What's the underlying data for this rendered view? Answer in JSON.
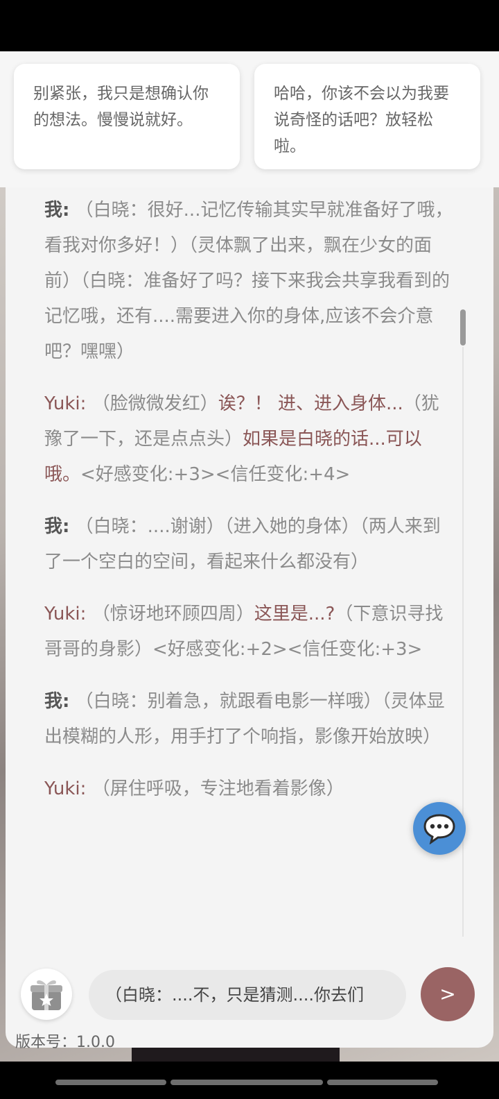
{
  "suggestions": [
    {
      "text": "别紧张，我只是想确认你的想法。慢慢说就好。"
    },
    {
      "text": "哈哈，你该不会以为我要说奇怪的话吧？放轻松啦。"
    }
  ],
  "messages": [
    {
      "speaker": "我:",
      "segments": [
        {
          "type": "action",
          "text": "（白晓：很好...记忆传输其实早就准备好了哦，看我对你多好！）（灵体飘了出来，飘在少女的面前）（白晓：准备好了吗？接下来我会共享我看到的记忆哦，还有....需要进入你的身体,应该不会介意吧？嘿嘿）"
        }
      ]
    },
    {
      "speaker": "Yuki:",
      "segments": [
        {
          "type": "action",
          "text": "（脸微微发红）"
        },
        {
          "type": "speech",
          "text": "诶？！ 进、进入身体..."
        },
        {
          "type": "action",
          "text": "（犹豫了一下，还是点点头）"
        },
        {
          "type": "speech",
          "text": "如果是白晓的话...可以哦。"
        },
        {
          "type": "action",
          "text": "<好感变化:+3><信任变化:+4>"
        }
      ]
    },
    {
      "speaker": "我:",
      "segments": [
        {
          "type": "action",
          "text": "（白晓：....谢谢）（进入她的身体）（两人来到了一个空白的空间，看起来什么都没有）"
        }
      ]
    },
    {
      "speaker": "Yuki:",
      "segments": [
        {
          "type": "action",
          "text": "（惊讶地环顾四周）"
        },
        {
          "type": "speech",
          "text": "这里是...?"
        },
        {
          "type": "action",
          "text": "（下意识寻找哥哥的身影）<好感变化:+2><信任变化:+3>"
        }
      ]
    },
    {
      "speaker": "我:",
      "segments": [
        {
          "type": "action",
          "text": "（白晓：别着急，就跟看电影一样哦）（灵体显出模糊的人形，用手打了个响指，影像开始放映）"
        }
      ]
    },
    {
      "speaker": "Yuki:",
      "segments": [
        {
          "type": "action",
          "text": "（屏住呼吸，专注地看着影像）"
        }
      ]
    }
  ],
  "input": {
    "value": "（白晓：....不，只是猜测....你去们"
  },
  "send_label": ">",
  "version_label": "版本号：1.0.0",
  "icons": {
    "chat": "chat-bubble-icon",
    "gift": "gift-icon"
  },
  "colors": {
    "accent": "#9a6464",
    "yuki_text": "#8a5656",
    "float_button": "#4b8fd6"
  }
}
